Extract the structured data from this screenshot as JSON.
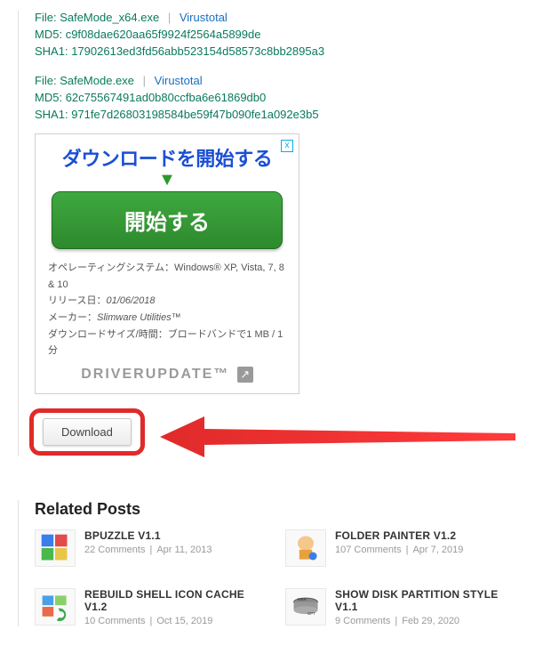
{
  "files": [
    {
      "file_label": "File:",
      "filename": "SafeMode_x64.exe",
      "vt_label": "Virustotal",
      "md5_label": "MD5:",
      "md5": "c9f08dae620aa65f9924f2564a5899de",
      "sha1_label": "SHA1:",
      "sha1": "17902613ed3fd56abb523154d58573c8bb2895a3"
    },
    {
      "file_label": "File:",
      "filename": "SafeMode.exe",
      "vt_label": "Virustotal",
      "md5_label": "MD5:",
      "md5": "62c75567491ad0b80ccfba6e61869db0",
      "sha1_label": "SHA1:",
      "sha1": "971fe7d26803198584be59f47b090fe1a092e3b5"
    }
  ],
  "ad": {
    "headline": "ダウンロードを開始する",
    "button": "開始する",
    "os_label": "オペレーティングシステム：",
    "os_value": "Windows® XP, Vista, 7, 8 & 10",
    "release_label": "リリース日：",
    "release_value": "01/06/2018",
    "maker_label": "メーカー：",
    "maker_value": "Slimware Utilities™",
    "size_label": "ダウンロードサイズ/時間：",
    "size_value": "ブロードバンドで1 MB / 1分",
    "brand": "DRIVERUPDATE",
    "brand_tm": "™",
    "close": "x"
  },
  "download": {
    "label": "Download"
  },
  "related": {
    "heading": "Related Posts",
    "posts": [
      {
        "title": "BPUZZLE V1.1",
        "comments": "22 Comments",
        "date": "Apr 11, 2013"
      },
      {
        "title": "FOLDER PAINTER V1.2",
        "comments": "107 Comments",
        "date": "Apr 7, 2019"
      },
      {
        "title": "REBUILD SHELL ICON CACHE V1.2",
        "comments": "10 Comments",
        "date": "Oct 15, 2019"
      },
      {
        "title": "SHOW DISK PARTITION STYLE V1.1",
        "comments": "9 Comments",
        "date": "Feb 29, 2020"
      }
    ]
  }
}
